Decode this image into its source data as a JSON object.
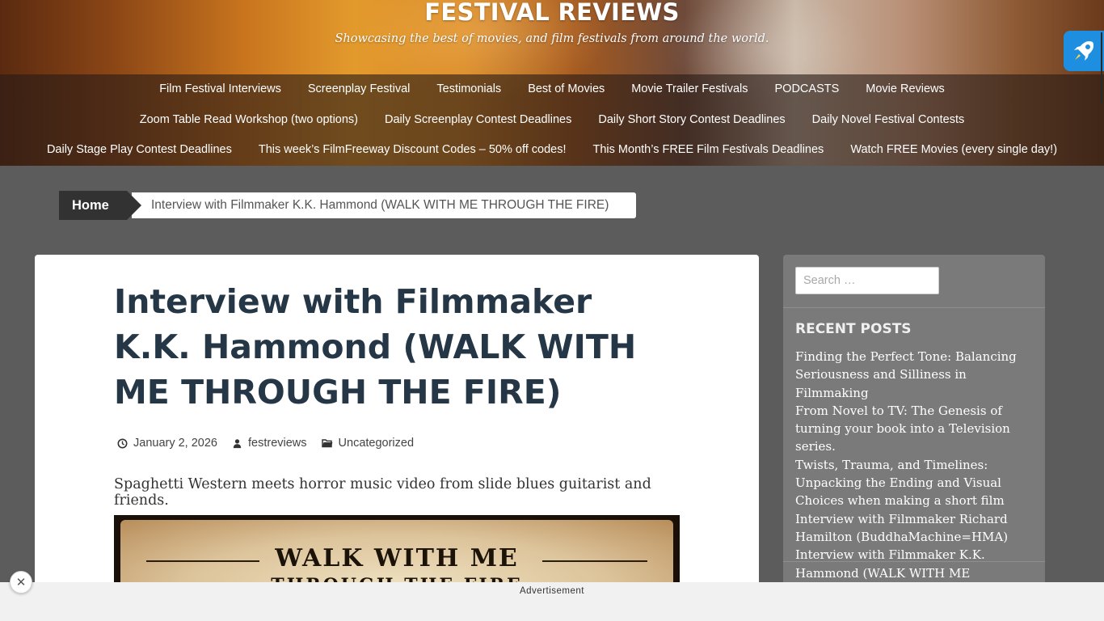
{
  "site": {
    "title": "FESTIVAL REVIEWS",
    "tagline": "Showcasing the best of movies, and film festivals from around the world."
  },
  "nav": {
    "row1": [
      "Film Festival Interviews",
      "Screenplay Festival",
      "Testimonials",
      "Best of Movies",
      "Movie Trailer Festivals",
      "PODCASTS",
      "Movie Reviews"
    ],
    "row2": [
      "Zoom Table Read Workshop (two options)",
      "Daily Screenplay Contest Deadlines",
      "Daily Short Story Contest Deadlines",
      "Daily Novel Festival Contests"
    ],
    "row3": [
      "Daily Stage Play Contest Deadlines",
      "This week’s FilmFreeway Discount Codes – 50% off codes!",
      "This Month’s FREE Film Festivals Deadlines",
      "Watch FREE Movies (every single day!)"
    ]
  },
  "breadcrumb": {
    "home": "Home",
    "current": "Interview with Filmmaker K.K. Hammond (WALK WITH ME THROUGH THE FIRE)"
  },
  "post": {
    "title": "Interview with Filmmaker K.K. Hammond (WALK WITH ME THROUGH THE FIRE)",
    "date": "January 2, 2026",
    "author": "festreviews",
    "category": "Uncategorized",
    "excerpt": "Spaghetti Western meets horror music video from slide blues guitarist and friends.",
    "poster_title": "WALK WITH ME",
    "poster_subtitle": "THROUGH THE FIRE"
  },
  "sidebar": {
    "search_placeholder": "Search …",
    "recent_title": "RECENT POSTS",
    "recent_posts": [
      "Finding the Perfect Tone: Balancing Seriousness and Silliness in Filmmaking",
      "From Novel to TV: The Genesis of turning your book into a Television series.",
      "Twists, Trauma, and Timelines: Unpacking the Ending and Visual Choices when making a short film",
      "Interview with Filmmaker Richard Hamilton (BuddhaMachine=HMA)",
      "Interview with Filmmaker K.K. Hammond (WALK WITH ME THROUGH THE FIRE)"
    ]
  },
  "ad": {
    "label": "Advertisement",
    "close_glyph": "✕"
  },
  "icons": {
    "clock": "clock-icon",
    "author": "user-icon",
    "category": "folder-icon",
    "rocket": "rocket-icon"
  },
  "colors": {
    "title_text": "#253746",
    "breadcrumb_dark": "#323232",
    "rocket_bg": "#1e8fe0"
  }
}
